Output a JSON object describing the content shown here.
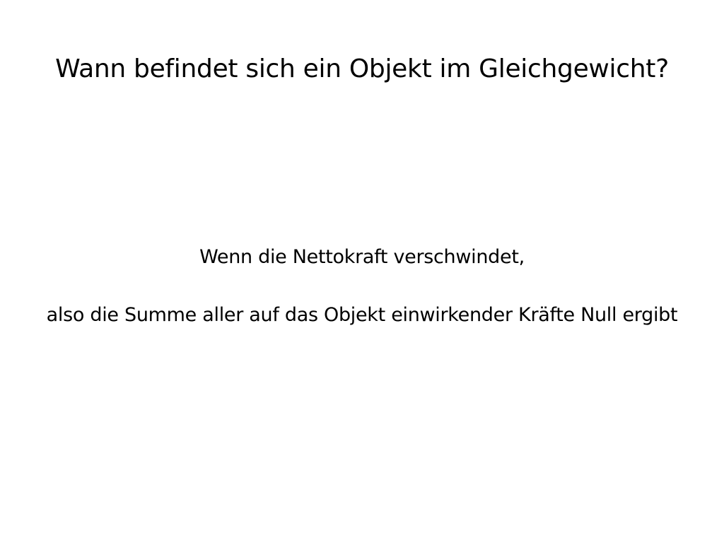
{
  "slide": {
    "title": "Wann befindet sich ein Objekt im Gleichgewicht?",
    "body_lines": [
      "Wenn die Nettokraft verschwindet,",
      "also die Summe aller auf das Objekt einwirkender Kräfte Null ergibt"
    ]
  }
}
